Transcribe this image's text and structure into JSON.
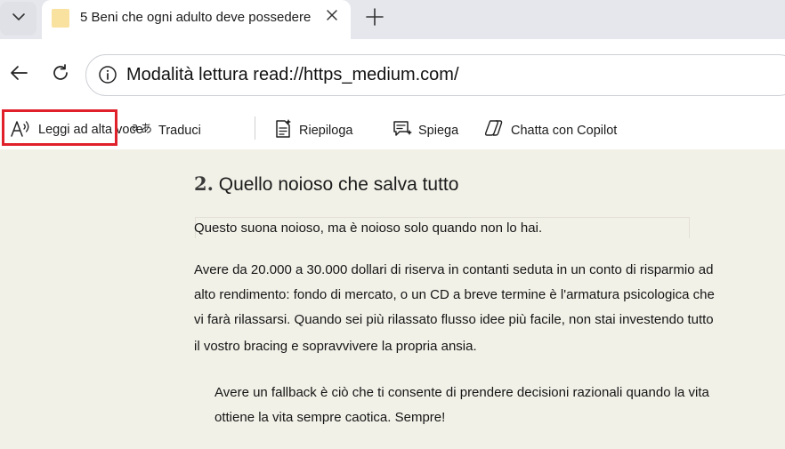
{
  "tab": {
    "title": "5 Beni che ogni adulto deve possedere"
  },
  "address_bar": {
    "text": "Modalità lettura read://https_medium.com/"
  },
  "reader_toolbar": {
    "read_aloud_label": "Leggi ad alta voce",
    "translate_label": "Traduci",
    "summarize_label": "Riepiloga",
    "explain_label": "Spiega",
    "copilot_label": "Chatta con Copilot",
    "highlight_color": "#e0202a"
  },
  "article": {
    "heading_number": "2.",
    "heading_text": "Quello noioso che salva tutto",
    "intro": "Questo suona noioso, ma è noioso solo quando non lo hai.",
    "body_lines": [
      "Avere da 20.000 a 30.000 dollari di riserva in contanti seduta in un conto di risparmio ad",
      "alto rendimento: fondo di mercato, o un CD a breve termine è l'armatura psicologica che",
      "vi farà rilassarsi. Quando sei più rilassato flusso idee più facile, non stai investendo tutto",
      "il vostro bracing e sopravvivere la propria ansia."
    ],
    "quote_lines": [
      "Avere un fallback è ciò che ti consente di prendere decisioni razionali quando la vita",
      "ottiene la vita sempre caotica. Sempre!"
    ]
  },
  "colors": {
    "reader_background": "#f2f1e8",
    "tabstrip_background": "#e5e7ec"
  }
}
